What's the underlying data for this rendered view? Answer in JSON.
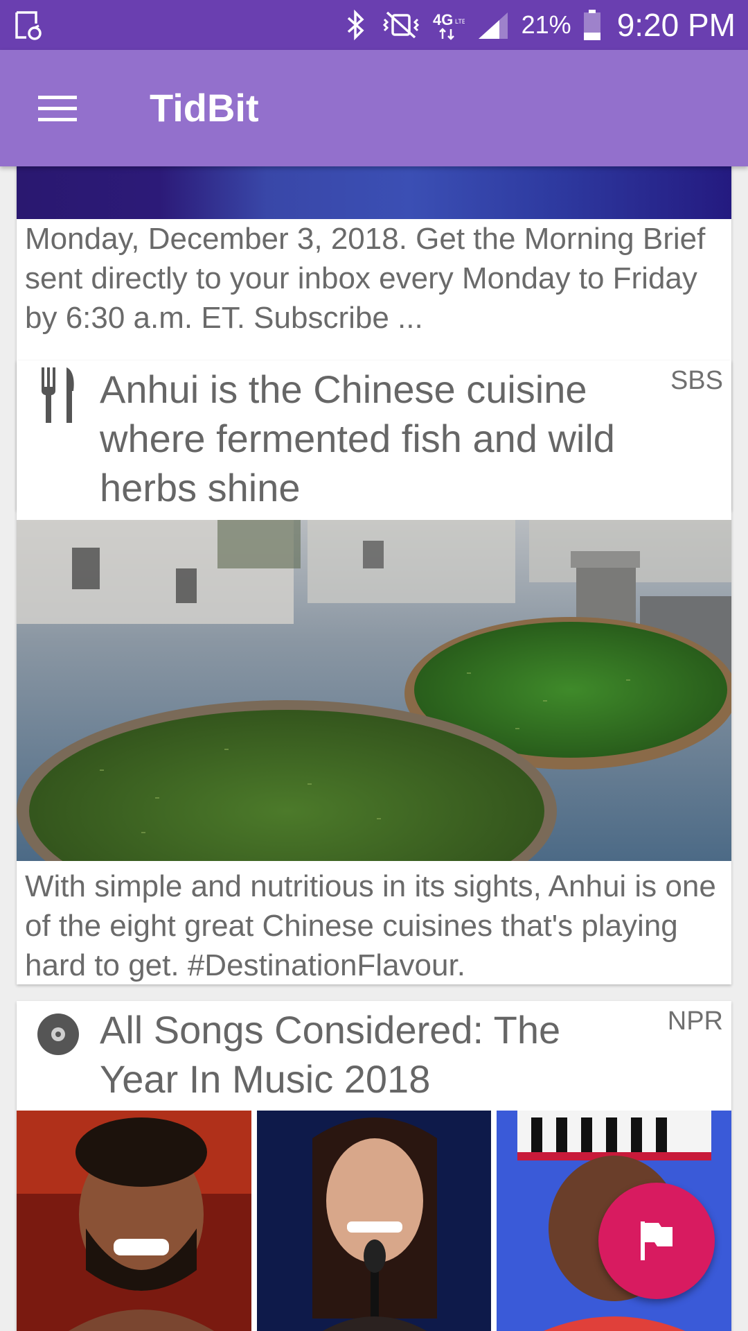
{
  "status_bar": {
    "battery_percent": "21%",
    "time": "9:20 PM",
    "icons": [
      "screenshot-icon",
      "bluetooth-icon",
      "vibrate-icon",
      "lte-icon",
      "signal-icon",
      "battery-icon"
    ]
  },
  "app_bar": {
    "title": "TidBit",
    "menu_icon": "hamburger-menu-icon"
  },
  "feed": {
    "cards": [
      {
        "summary": "Monday, December 3, 2018. Get the Morning Brief sent directly to your inbox every Monday to Friday by 6:30 a.m. ET. Subscribe ..."
      },
      {
        "category_icon": "fork-knife-icon",
        "title": "Anhui is the Chinese cuisine where fermented fish and wild herbs shine",
        "source": "SBS",
        "summary": "With simple and nutritious in its sights, Anhui is one of the eight great Chinese cuisines that's playing hard to get. #DestinationFlavour."
      },
      {
        "category_icon": "disc-icon",
        "title": "All Songs Considered: The Year In Music 2018",
        "source": "NPR"
      }
    ]
  },
  "fab": {
    "icon": "flag-icon",
    "color": "#d81b60"
  },
  "colors": {
    "status_bar": "#6a3fb0",
    "app_bar": "#9370cc",
    "accent": "#d81b60"
  }
}
